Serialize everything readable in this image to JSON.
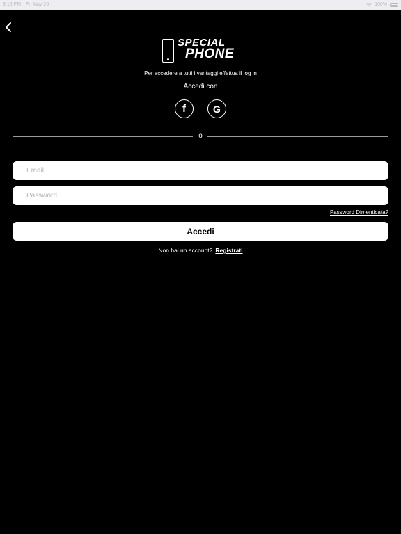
{
  "status_bar": {
    "time": "9:16 PM",
    "date": "Fri May 26",
    "battery": "100%"
  },
  "logo": {
    "line1": "SPECIAL",
    "line2": "PHONE"
  },
  "subtitle": "Per accedere a tutti i vantaggi effettua il log in",
  "social": {
    "heading": "Accedi con",
    "facebook_glyph": "f",
    "google_glyph": "G"
  },
  "divider_text": "o",
  "form": {
    "email_placeholder": "Email",
    "email_value": "",
    "password_placeholder": "Password",
    "password_value": "",
    "forgot_password": "Password Dimenticata?",
    "login_button": "Accedi"
  },
  "register": {
    "prompt": "Non hai un account?",
    "link": "Registrati"
  },
  "colors": {
    "background": "#000000",
    "text": "#ffffff",
    "status_bar": "#eeeef2",
    "input_background": "#ffffff"
  },
  "icons": {
    "back": "chevron-left-icon",
    "wifi": "wifi-icon",
    "battery": "battery-icon",
    "facebook": "facebook-icon",
    "google": "google-icon"
  }
}
